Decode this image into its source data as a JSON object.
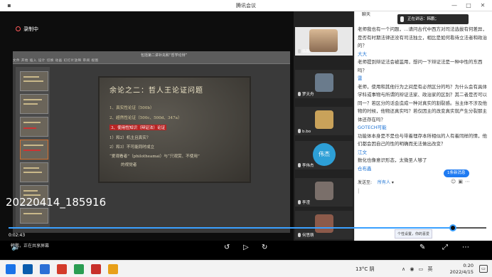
{
  "window": {
    "title": "腾讯会议"
  },
  "recording": {
    "label": "录制中"
  },
  "ppt": {
    "window_title": "包括第二讲补充和“哲学论辩”",
    "tabs": "文件  开始  插入  设计  切换  动画  幻灯片放映  审阅  视图"
  },
  "slide": {
    "title": "余论之二：哲人王论证问题",
    "lines": [
      "1、真实性论证（500b）",
      "2、超然性论证（500c、500d、347a）",
      "3、使用性知识（辩证法）论证",
      "1）和2）机主且真实？",
      "2）和3）不可能同时成立",
      "“爱观看者”（philotheamai）与“只观赏、不使用”",
      "的视觉者"
    ]
  },
  "participants": [
    {
      "name": "韩鹏",
      "kind": "video"
    },
    {
      "name": "罗天舟",
      "kind": "avatar"
    },
    {
      "name": "b.bo",
      "kind": "avatar"
    },
    {
      "name": "李伟杰",
      "kind": "circle",
      "initials": "伟杰"
    },
    {
      "name": "李滢",
      "kind": "avatar"
    },
    {
      "name": "何思萌",
      "kind": "avatar"
    }
  ],
  "chat": {
    "header": "聊天",
    "speaking": "正在讲话：韩鹏；",
    "messages": [
      {
        "sender": "",
        "text": "老师我也有一个问题，…请问古代中西方对司法选拔有何差异，是否有时期法律还没有司法独立，相比是如何看待立法者和政治的？"
      },
      {
        "sender": "大大",
        "text": "老师提到辩证法会被滥用，想问一下辩证法是一种中性的东西吗？"
      },
      {
        "sender": "雷",
        "text": "老师，使用和其他行为之间是有必然区分的吗？为什么会有具体学科或事物与所谓的辩证法家、政治家的区别？其二者是否可以同一？若区分的话会造成一种对真实的割裂感。当主体不涉及他物的时候，他物还真实吗？若仅因主的改变真实就产生分裂那主体还存在吗？"
      },
      {
        "sender": "GOTECH可能",
        "text": "功能体本身是不是也与带着理存本所相似的人有着同样的情，他们都会因自己的性的明确而无法做出改变？"
      },
      {
        "sender": "江文",
        "text": "数化也像意识形态，太微圣人够了"
      },
      {
        "sender": "仓布鑫",
        "text": ""
      }
    ],
    "new_messages": "1条新消息",
    "send_to_label": "发送至:",
    "send_to_value": "所有人",
    "input_placeholder": "|"
  },
  "player": {
    "title": "20220414_185916",
    "time_current": "0:02:43",
    "time_total": "2:28:03",
    "progress": 0.93,
    "tooltip": "个性设置，你的喜爱",
    "share_info": "韩鹏，正在共享屏幕"
  },
  "taskbar": {
    "weather": "13°C  阴",
    "time": "0:20",
    "date": "2022/4/15",
    "sys_icons": "∧  ◉  ▭  英"
  }
}
